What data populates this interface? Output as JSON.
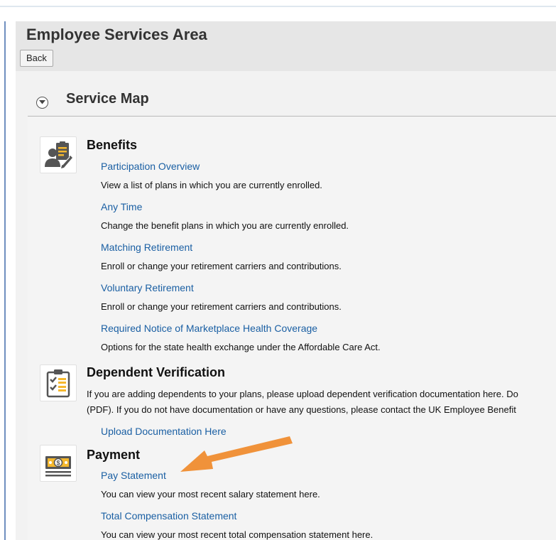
{
  "header": {
    "title": "Employee Services Area",
    "back_label": "Back"
  },
  "service_map": {
    "title": "Service Map"
  },
  "benefits": {
    "title": "Benefits",
    "items": [
      {
        "link": "Participation Overview",
        "desc": "View a list of plans in which you are currently enrolled."
      },
      {
        "link": "Any Time",
        "desc": "Change the benefit plans in which you are currently enrolled."
      },
      {
        "link": "Matching Retirement",
        "desc": "Enroll or change your retirement carriers and contributions."
      },
      {
        "link": "Voluntary Retirement",
        "desc": "Enroll or change your retirement carriers and contributions."
      },
      {
        "link": "Required Notice of Marketplace Health Coverage",
        "desc": "Options for the state health exchange under the Affordable Care Act."
      }
    ]
  },
  "dependent_verification": {
    "title": "Dependent Verification",
    "line1": "If you are adding dependents to your plans, please upload dependent verification documentation here. Do",
    "line2": "(PDF). If you do not have documentation or have any questions, please contact the UK Employee Benefit",
    "link": "Upload Documentation Here"
  },
  "payment": {
    "title": "Payment",
    "items": [
      {
        "link": "Pay Statement",
        "desc": "You can view your most recent salary statement here."
      },
      {
        "link": "Total Compensation Statement",
        "desc": "You can view your most recent total compensation statement here."
      }
    ]
  },
  "icons": {
    "benefits": "person-clipboard-icon",
    "dependent": "checklist-icon",
    "payment": "money-icon",
    "annotation": "orange-arrow"
  },
  "colors": {
    "link": "#1a5fa3",
    "annotation_arrow": "#f0923a",
    "icon_accent": "#f5b82e"
  }
}
